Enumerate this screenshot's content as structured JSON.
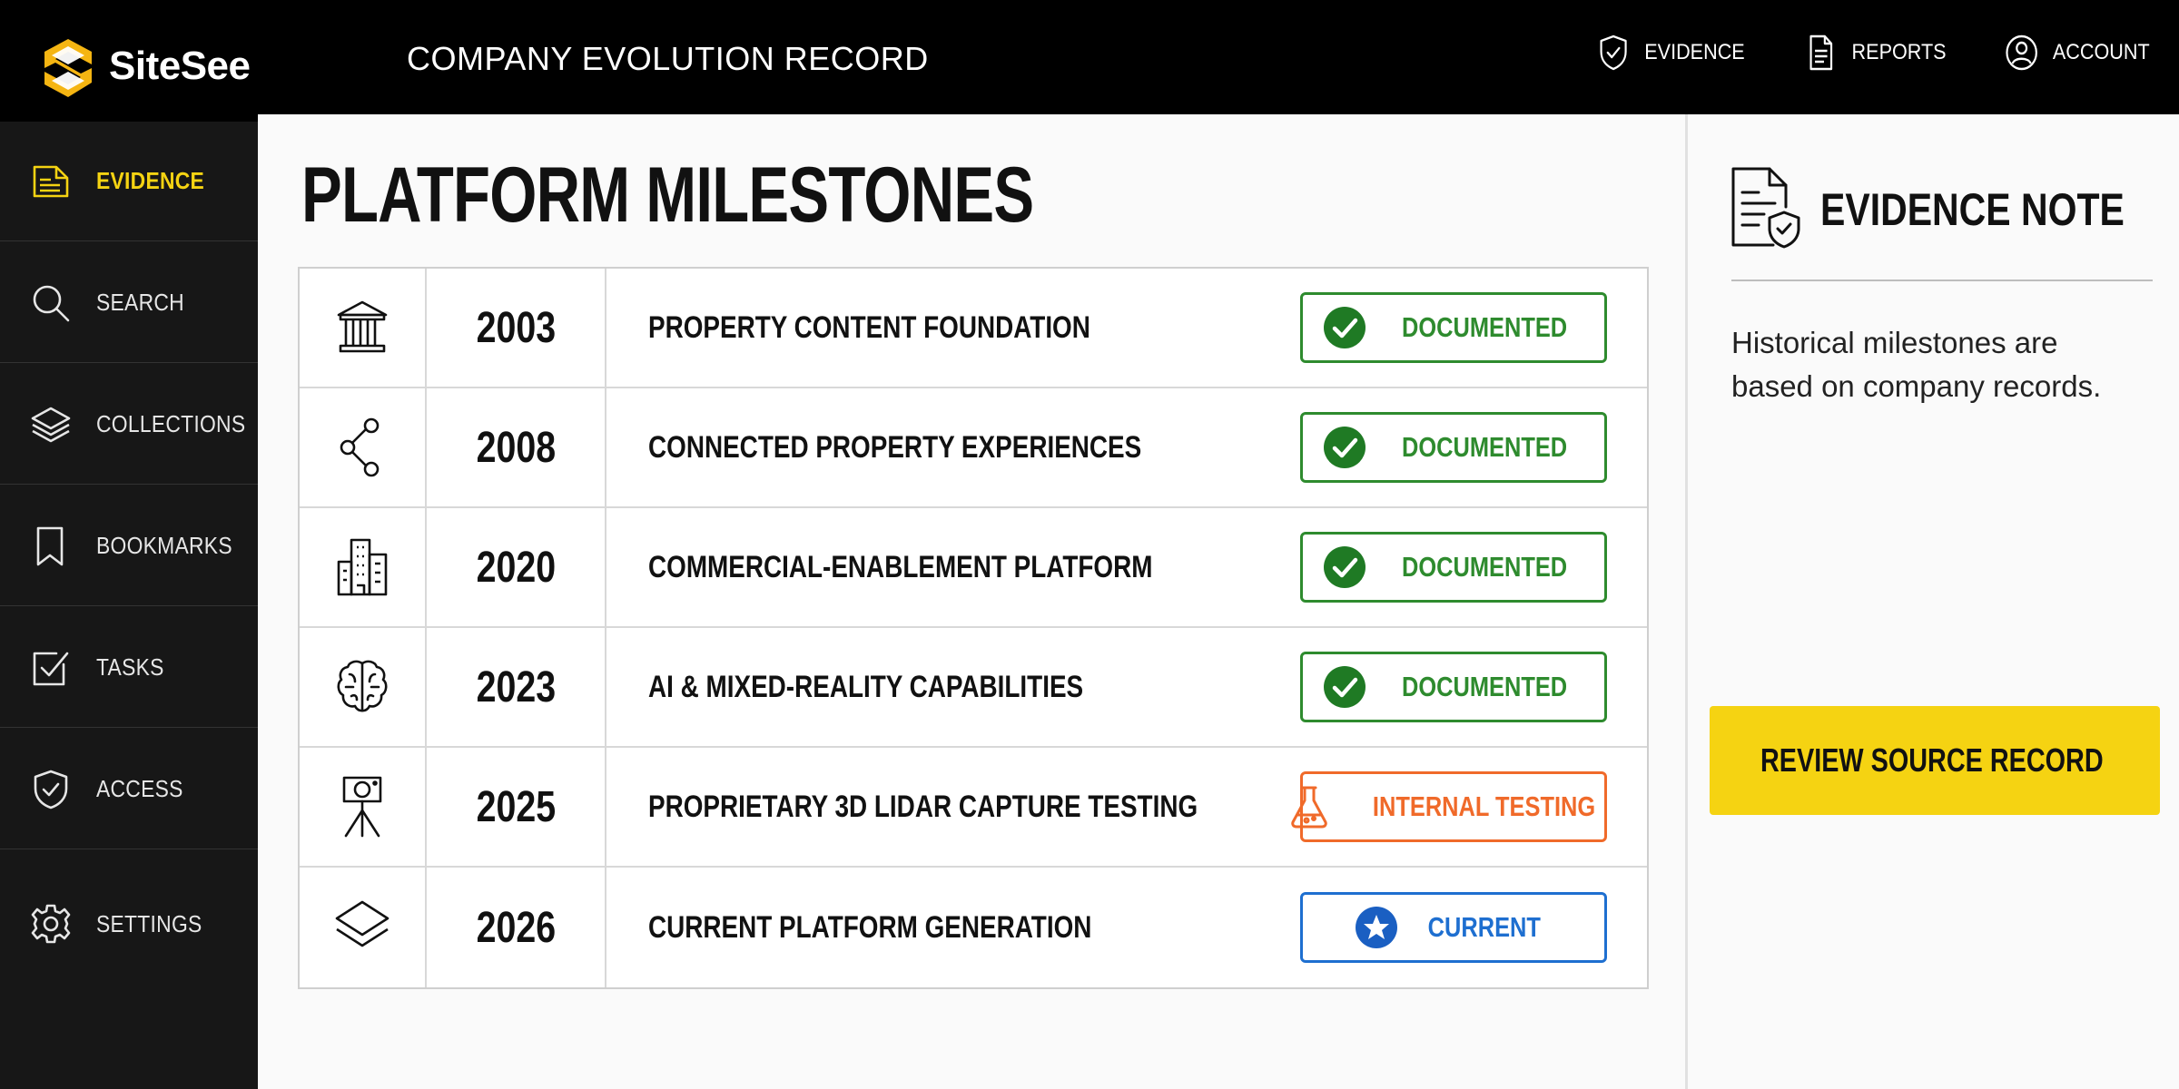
{
  "app": {
    "brand": "SiteSee",
    "title": "COMPANY EVOLUTION RECORD"
  },
  "topnav": [
    {
      "label": "EVIDENCE",
      "icon": "shield-check-icon"
    },
    {
      "label": "REPORTS",
      "icon": "document-icon"
    },
    {
      "label": "ACCOUNT",
      "icon": "user-circle-icon"
    }
  ],
  "sidebar": {
    "items": [
      {
        "label": "EVIDENCE",
        "icon": "evidence-doc-icon",
        "active": true
      },
      {
        "label": "SEARCH",
        "icon": "search-icon"
      },
      {
        "label": "COLLECTIONS",
        "icon": "layers-icon"
      },
      {
        "label": "BOOKMARKS",
        "icon": "bookmark-icon"
      },
      {
        "label": "TASKS",
        "icon": "checkbox-icon"
      },
      {
        "label": "ACCESS",
        "icon": "shield-check-icon"
      },
      {
        "label": "SETTINGS",
        "icon": "gear-icon"
      }
    ]
  },
  "main": {
    "title": "PLATFORM MILESTONES",
    "milestones": [
      {
        "year": "2003",
        "title": "PROPERTY CONTENT FOUNDATION",
        "icon": "institution-icon",
        "status": "DOCUMENTED",
        "status_icon": "check-circle-icon"
      },
      {
        "year": "2008",
        "title": "CONNECTED PROPERTY EXPERIENCES",
        "icon": "share-nodes-icon",
        "status": "DOCUMENTED",
        "status_icon": "check-circle-icon"
      },
      {
        "year": "2020",
        "title": "COMMERCIAL-ENABLEMENT PLATFORM",
        "icon": "buildings-icon",
        "status": "DOCUMENTED",
        "status_icon": "check-circle-icon"
      },
      {
        "year": "2023",
        "title": "AI & MIXED-REALITY CAPABILITIES",
        "icon": "brain-icon",
        "status": "DOCUMENTED",
        "status_icon": "check-circle-icon"
      },
      {
        "year": "2025",
        "title": "PROPRIETARY 3D LIDAR CAPTURE TESTING",
        "icon": "lidar-tripod-icon",
        "status": "INTERNAL TESTING",
        "status_icon": "flask-icon"
      },
      {
        "year": "2026",
        "title": "CURRENT PLATFORM GENERATION",
        "icon": "layers-icon",
        "status": "CURRENT",
        "status_icon": "star-circle-icon"
      }
    ]
  },
  "panel": {
    "title": "EVIDENCE NOTE",
    "text": "Historical milestones are based on company records.",
    "button_label": "REVIEW SOURCE RECORD",
    "button_icon": "document-search-icon"
  },
  "colors": {
    "accent_yellow": "#f5d312",
    "documented_green": "#2e8b2e",
    "testing_orange": "#f06a2a",
    "current_blue": "#1e6fd0",
    "sidebar_bg": "#171717",
    "topbar_bg": "#000000"
  }
}
